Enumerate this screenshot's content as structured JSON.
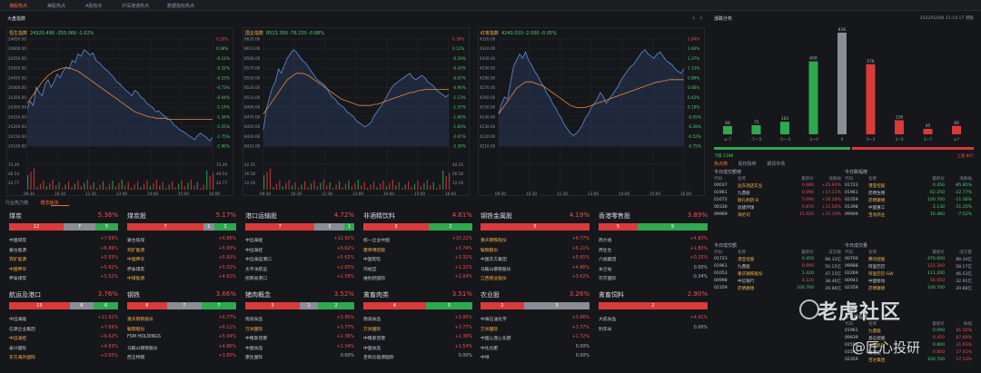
{
  "top_tabs": [
    "港股热点",
    "美股热点",
    "A股热点",
    "沪深港通热点",
    "数据指标热点"
  ],
  "section_title": "大盘指数",
  "charts": [
    {
      "name": "恒生指数",
      "value": "24320.490 -250.060 -1.02%",
      "y_labels": [
        "24650.00",
        "24600.00",
        "24550.00",
        "24500.00",
        "24450.00",
        "24400.00",
        "24350.00",
        "24300.00",
        "24250.00",
        "24200.00",
        "24150.00",
        "24100.00"
      ],
      "pct_labels": [
        "0.29%",
        "0.08%",
        "-0.12%",
        "-0.32%",
        "-0.53%",
        "-0.73%",
        "-0.94%",
        "-1.14%",
        "-1.34%",
        "-1.55%",
        "-1.75%",
        "-1.96%"
      ],
      "vol_labels": [
        "74.39",
        "48.54",
        "24.77"
      ],
      "vol_labels_r": [
        "74.39",
        "49.54",
        "24.77"
      ],
      "x_labels": [
        "09:30",
        "10:30",
        "11:30",
        "13:00",
        "14:00",
        "15:00",
        "16:00"
      ],
      "line": [
        0.35,
        0.42,
        0.38,
        0.55,
        0.5,
        0.47,
        0.58,
        0.62,
        0.55,
        0.6,
        0.67,
        0.64,
        0.7,
        0.74,
        0.72,
        0.8,
        0.78,
        0.86,
        0.84,
        0.9,
        0.88,
        0.85,
        0.87,
        0.8,
        0.78,
        0.75,
        0.72,
        0.7,
        0.67,
        0.64,
        0.6,
        0.58,
        0.55,
        0.52,
        0.5,
        0.47,
        0.52,
        0.5,
        0.46,
        0.44,
        0.4,
        0.38,
        0.36,
        0.32,
        0.33,
        0.3,
        0.28,
        0.26,
        0.24,
        0.2,
        0.18,
        0.15,
        0.14,
        0.12,
        0.1,
        0.08,
        0.06,
        0.1,
        0.12,
        0.1,
        0.08,
        0.05,
        0.08
      ],
      "avg": [
        0.4,
        0.44,
        0.48,
        0.52,
        0.56,
        0.6,
        0.63,
        0.66,
        0.68,
        0.7,
        0.71,
        0.72,
        0.73,
        0.73,
        0.73,
        0.72,
        0.71,
        0.7,
        0.68,
        0.66,
        0.64,
        0.62,
        0.6,
        0.58,
        0.56,
        0.54,
        0.52,
        0.5,
        0.48,
        0.46,
        0.44,
        0.42,
        0.4,
        0.38,
        0.36,
        0.34,
        0.32,
        0.31,
        0.3,
        0.29,
        0.28,
        0.27,
        0.27,
        0.26,
        0.26,
        0.26,
        0.26,
        0.25,
        0.25,
        0.25,
        0.25,
        0.25,
        0.25,
        0.25,
        0.25,
        0.25,
        0.25,
        0.25,
        0.25,
        0.25,
        0.25,
        0.25,
        0.25
      ]
    },
    {
      "name": "国企指数",
      "value": "8513.300 -76.230 -0.88%",
      "y_labels": [
        "8620.00",
        "8610.00",
        "8590.00",
        "8570.00",
        "8550.00",
        "8530.00",
        "8510.00",
        "8490.00",
        "8470.00",
        "8450.00",
        "8430.00",
        "8410.00"
      ],
      "pct_labels": [
        "0.38%",
        "0.12%",
        "-0.19%",
        "-0.43%",
        "-0.67%",
        "-0.90%",
        "-1.13%",
        "-1.37%",
        "-1.60%",
        "-1.83%",
        "-2.07%",
        "-2.30%"
      ],
      "vol_labels": [
        "42.35",
        "26.58",
        "12.29"
      ],
      "vol_labels_r": [
        "40.25",
        "26.58",
        "12.29"
      ],
      "x_labels": [
        "09:30",
        "10:30",
        "11:30",
        "13:00",
        "14:00",
        "15:00",
        "16:00"
      ],
      "line": [
        0.15,
        0.35,
        0.45,
        0.55,
        0.6,
        0.72,
        0.68,
        0.75,
        0.82,
        0.86,
        0.9,
        0.88,
        0.84,
        0.8,
        0.78,
        0.74,
        0.7,
        0.66,
        0.62,
        0.6,
        0.58,
        0.55,
        0.5,
        0.46,
        0.44,
        0.4,
        0.38,
        0.36,
        0.32,
        0.3,
        0.28,
        0.24,
        0.22,
        0.2,
        0.18,
        0.2,
        0.22,
        0.28,
        0.32,
        0.36,
        0.4,
        0.45,
        0.5,
        0.55,
        0.58,
        0.6,
        0.62,
        0.64,
        0.66,
        0.68,
        0.64,
        0.62,
        0.64,
        0.66,
        0.64,
        0.6,
        0.58,
        0.56,
        0.52,
        0.5,
        0.48,
        0.46,
        0.48
      ],
      "avg": [
        0.3,
        0.34,
        0.38,
        0.42,
        0.46,
        0.5,
        0.54,
        0.58,
        0.62,
        0.64,
        0.66,
        0.68,
        0.68,
        0.68,
        0.67,
        0.66,
        0.64,
        0.62,
        0.6,
        0.58,
        0.56,
        0.54,
        0.52,
        0.5,
        0.48,
        0.46,
        0.44,
        0.43,
        0.42,
        0.41,
        0.4,
        0.39,
        0.38,
        0.38,
        0.38,
        0.38,
        0.38,
        0.39,
        0.39,
        0.4,
        0.41,
        0.42,
        0.43,
        0.44,
        0.45,
        0.46,
        0.47,
        0.48,
        0.49,
        0.5,
        0.5,
        0.51,
        0.52,
        0.52,
        0.53,
        0.53,
        0.53,
        0.53,
        0.53,
        0.53,
        0.53,
        0.53,
        0.53
      ]
    },
    {
      "name": "红筹指数",
      "value": "4243.010 -2.000 -0.05%",
      "y_labels": [
        "4320.00",
        "4310.00",
        "4300.00",
        "4290.00",
        "4280.00",
        "4270.00",
        "4260.00",
        "4250.00",
        "4240.00",
        "4230.00",
        "4220.00",
        "4210.00"
      ],
      "pct_labels": [
        "1.84%",
        "1.60%",
        "1.37%",
        "1.13%",
        "0.89%",
        "0.66%",
        "0.42%",
        "0.19%",
        "-0.05%",
        "-0.28%",
        "-0.52%",
        "-0.75%"
      ],
      "vol_labels": [
        "",
        "",
        ""
      ],
      "vol_labels_r": [
        "",
        "",
        ""
      ],
      "x_labels": [
        "09:30",
        "10:30",
        "11:30",
        "13:00",
        "14:00",
        "15:00",
        "16:00"
      ],
      "line": [
        0.3,
        0.4,
        0.46,
        0.44,
        0.6,
        0.75,
        0.8,
        0.86,
        0.82,
        0.88,
        0.8,
        0.76,
        0.7,
        0.66,
        0.6,
        0.56,
        0.5,
        0.46,
        0.4,
        0.36,
        0.3,
        0.26,
        0.2,
        0.16,
        0.12,
        0.1,
        0.12,
        0.15,
        0.2,
        0.26,
        0.3,
        0.36,
        0.4,
        0.44,
        0.5,
        0.46,
        0.4,
        0.44,
        0.48,
        0.52,
        0.56,
        0.62,
        0.66,
        0.7,
        0.74,
        0.76,
        0.8,
        0.84,
        0.88,
        0.9,
        0.86,
        0.84,
        0.82,
        0.86,
        0.88,
        0.84,
        0.8,
        0.78,
        0.76,
        0.72,
        0.7,
        0.68,
        0.72
      ],
      "avg": [
        0.3,
        0.34,
        0.38,
        0.42,
        0.46,
        0.5,
        0.54,
        0.56,
        0.58,
        0.6,
        0.6,
        0.6,
        0.59,
        0.58,
        0.57,
        0.56,
        0.54,
        0.52,
        0.5,
        0.48,
        0.46,
        0.44,
        0.42,
        0.4,
        0.38,
        0.37,
        0.36,
        0.36,
        0.36,
        0.36,
        0.37,
        0.38,
        0.39,
        0.4,
        0.41,
        0.42,
        0.43,
        0.44,
        0.45,
        0.46,
        0.47,
        0.48,
        0.49,
        0.5,
        0.51,
        0.52,
        0.53,
        0.54,
        0.55,
        0.56,
        0.57,
        0.58,
        0.59,
        0.6,
        0.6,
        0.61,
        0.61,
        0.62,
        0.62,
        0.62,
        0.62,
        0.62,
        0.62
      ]
    }
  ],
  "sector_tabs": [
    "行业热力榜",
    "概念板块"
  ],
  "sectors": [
    {
      "name": "煤炭",
      "pct": "5.36%",
      "bar": [
        12,
        7,
        5
      ],
      "stocks": [
        [
          "中国煤炭",
          "+7.69%",
          false
        ],
        [
          "蒙古能源",
          "+6.86%",
          false
        ],
        [
          "兖矿能源",
          "+5.93%",
          true
        ],
        [
          "中国神华",
          "+5.92%",
          true
        ],
        [
          "伊泰煤炭",
          "+5.52%",
          false
        ]
      ]
    },
    {
      "name": "煤炭股",
      "pct": "5.17%",
      "bar": [
        7,
        1,
        2
      ],
      "stocks": [
        [
          "蒙古焦煤",
          "+6.86%",
          false
        ],
        [
          "兖矿能源",
          "+5.93%",
          true
        ],
        [
          "中国神华",
          "+5.92%",
          true
        ],
        [
          "伊泰煤炭",
          "+5.52%",
          false
        ],
        [
          "中煤能源",
          "+4.62%",
          true
        ]
      ]
    },
    {
      "name": "港口运输股",
      "pct": "4.72%",
      "bar": [
        7,
        3,
        1
      ],
      "stocks": [
        [
          "中远海能",
          "+11.92%",
          false
        ],
        [
          "中远海控",
          "+6.62%",
          false
        ],
        [
          "中远海运港口",
          "+5.62%",
          false
        ],
        [
          "太平洋航运",
          "+2.65%",
          false
        ],
        [
          "招商局港口",
          "+2.58%",
          false
        ]
      ]
    },
    {
      "name": "非酒精饮料",
      "pct": "4.61%",
      "bar": [
        3,
        0,
        2
      ],
      "stocks": [
        [
          "统一企业中国",
          "+10.22%",
          false
        ],
        [
          "康师傅控股",
          "+3.74%",
          true
        ],
        [
          "中国旺旺",
          "+3.32%",
          false
        ],
        [
          "鸿福堂",
          "+1.32%",
          false
        ],
        [
          "维他奶国际",
          "+1.04%",
          false
        ]
      ]
    },
    {
      "name": "钢铁金属股",
      "pct": "4.19%",
      "bar": [
        5,
        0,
        0
      ],
      "stocks": [
        [
          "重庆钢铁股份",
          "+6.77%",
          true
        ],
        [
          "鞍钢股份",
          "+6.11%",
          true
        ],
        [
          "中国东方集团",
          "+5.65%",
          false
        ],
        [
          "马鞍山钢铁股份",
          "+4.86%",
          false
        ],
        [
          "江西铜业股份",
          "+3.62%",
          true
        ]
      ]
    },
    {
      "name": "香港零售股",
      "pct": "3.89%",
      "bar": [
        5,
        0,
        9
      ],
      "stocks": [
        [
          "周大福",
          "+4.83%",
          false
        ],
        [
          "周生生",
          "+1.83%",
          false
        ],
        [
          "六福集团",
          "+0.25%",
          false
        ],
        [
          "米兰站",
          "0.00%",
          false
        ],
        [
          "莎莎国际",
          "-0.34%",
          false
        ]
      ]
    },
    {
      "name": "航运及港口",
      "pct": "3.76%",
      "bar": [
        15,
        6,
        6
      ],
      "stocks": [
        [
          "中远海能",
          "+11.92%",
          false
        ],
        [
          "信源企业集团",
          "+7.69%",
          false
        ],
        [
          "中远海控",
          "+6.62%",
          true
        ],
        [
          "泰兴国际",
          "+4.63%",
          false
        ],
        [
          "东方海外国际",
          "+3.65%",
          true
        ]
      ]
    },
    {
      "name": "钢铁",
      "pct": "3.66%",
      "bar": [
        8,
        7,
        7
      ],
      "stocks": [
        [
          "重庆钢铁股份",
          "+6.77%",
          true
        ],
        [
          "鞍钢股份",
          "+6.11%",
          true
        ],
        [
          "FSM HOLDINGS",
          "+5.94%",
          false
        ],
        [
          "马鞍山钢铁股份",
          "+4.86%",
          false
        ],
        [
          "西王特钢",
          "+3.85%",
          false
        ]
      ]
    },
    {
      "name": "猪肉概念",
      "pct": "3.52%",
      "bar": [
        3,
        1,
        2
      ],
      "stocks": [
        [
          "雨润食品",
          "+3.95%",
          false
        ],
        [
          "万洲国际",
          "+3.77%",
          true
        ],
        [
          "中粮家佳康",
          "+1.36%",
          false
        ],
        [
          "中国食品",
          "+1.34%",
          false
        ],
        [
          "康生国际",
          "0.00%",
          false
        ]
      ]
    },
    {
      "name": "禽畜肉类",
      "pct": "3.51%",
      "bar": [
        4,
        0,
        3
      ],
      "stocks": [
        [
          "雨润食品",
          "+3.95%",
          false
        ],
        [
          "万洲国际",
          "+3.77%",
          true
        ],
        [
          "中粮家佳康",
          "+1.36%",
          false
        ],
        [
          "中国食品",
          "+1.54%",
          false
        ],
        [
          "百和比能源国际",
          "0.00%",
          false
        ]
      ]
    },
    {
      "name": "农业股",
      "pct": "3.26%",
      "bar": [
        2,
        3,
        0
      ],
      "stocks": [
        [
          "中海石油化学",
          "+3.96%",
          false
        ],
        [
          "万洲国际",
          "+3.77%",
          true
        ],
        [
          "中国心连心化肥",
          "+1.72%",
          false
        ],
        [
          "中化化肥",
          "0.00%",
          false
        ],
        [
          "中绿",
          "0.00%",
          false
        ]
      ]
    },
    {
      "name": "禽畜饲料",
      "pct": "2.90%",
      "bar": [
        2,
        0,
        0
      ],
      "stocks": [
        [
          "大成食品",
          "+4.41%",
          false
        ],
        [
          "利华米",
          "0.00%",
          false
        ]
      ]
    }
  ],
  "distribution": {
    "title": "涨跌分布",
    "datetime": "2022/02/08 21:14:17 港股",
    "categories": [
      "≤-7",
      "-7~-5",
      "-5~-3",
      "-3~0",
      "0",
      "0~3",
      "3~5",
      "5~7",
      "≥7"
    ],
    "values": [
      68,
      75,
      103,
      600,
      836,
      576,
      116,
      45,
      69
    ],
    "colors": [
      "#2fa84f",
      "#2fa84f",
      "#2fa84f",
      "#2fa84f",
      "#8a8d94",
      "#d93a3a",
      "#d93a3a",
      "#d93a3a",
      "#d93a3a"
    ],
    "down_label": "下跌 1196",
    "up_label": "上涨 807"
  },
  "hot_tabs": [
    "热点榜",
    "股权融券",
    "期货市场"
  ],
  "tables": [
    {
      "title": "今日成交额榜",
      "headers": [
        "代码",
        "名称",
        "最新价",
        "涨跌幅"
      ],
      "rows": [
        [
          "00037",
          "远东酒店实业",
          "0.680",
          "+25.93%",
          true
        ],
        [
          "01961",
          "九鼎股",
          "0.090",
          "+17.11%",
          false
        ],
        [
          "01672",
          "歌礼制药-B",
          "5.090",
          "+16.28%",
          false
        ],
        [
          "00330",
          "思捷环球",
          "0.870",
          "+11.54%",
          false
        ],
        [
          "09969",
          "海伦司",
          "15.920",
          "+11.19%",
          false
        ]
      ]
    },
    {
      "title": "今日跌幅榜",
      "headers": [
        "代码",
        "名称",
        "最新价",
        "涨跌幅"
      ],
      "rows": [
        [
          "01723",
          "港亚控股",
          "0.450",
          "-85.85%",
          false
        ],
        [
          "01961",
          "药明生物",
          "62.250",
          "-22.77%",
          false
        ],
        [
          "02359",
          "药明康德",
          "100.700",
          "-11.36%",
          false
        ],
        [
          "01398",
          "中国重工",
          "2.130",
          "-11.25%",
          false
        ],
        [
          "09909",
          "宝龙商业",
          "16.480",
          "-7.52%",
          false
        ]
      ]
    },
    {
      "title": "今日成交额",
      "headers": [
        "代码",
        "名称",
        "最新价",
        "成交额"
      ],
      "rows": [
        [
          "01723",
          "港亚控股",
          "0.450",
          "88.33亿",
          false
        ],
        [
          "01961",
          "九鼎股",
          "0.090",
          "50.15亿",
          false
        ],
        [
          "01053",
          "重庆钢铁股份",
          "1.420",
          "47.15亿",
          false
        ],
        [
          "00998",
          "中信银行",
          "4.120",
          "38.46亿",
          false
        ],
        [
          "02359",
          "药明康德",
          "100.700",
          "29.88亿",
          false
        ]
      ]
    },
    {
      "title": "今日成交量",
      "headers": [
        "代码",
        "名称",
        "最新价",
        "成交量"
      ],
      "rows": [
        [
          "00700",
          "腾讯控股",
          "470.000",
          "88.34亿",
          false
        ],
        [
          "09988",
          "阿里巴巴",
          "125.300",
          "58.17亿",
          false
        ],
        [
          "02269",
          "阿里巴巴-SW",
          "111.200",
          "46.53亿",
          false
        ],
        [
          "00941",
          "中国移动",
          "56.050",
          "32.91亿",
          false
        ],
        [
          "02359",
          "药明康德",
          "100.700",
          "29.88亿",
          false
        ]
      ]
    },
    {
      "title": "今日振幅榜",
      "headers": [
        "代码",
        "名称",
        "最新价",
        "振幅"
      ],
      "rows": [
        [
          "01961",
          "九鼎股",
          "0.090",
          "81.56%",
          false
        ],
        [
          "09939",
          "基石控股",
          "0.450",
          "87.84%",
          false
        ],
        [
          "01598",
          "中国移动",
          "0.800",
          "31.63%",
          false
        ],
        [
          "01592",
          "康而健",
          "0.850",
          "27.41%",
          false
        ],
        [
          "02359",
          "百达集团",
          "100.700",
          "27.13%",
          false
        ]
      ]
    }
  ],
  "watermark": {
    "main": "老虎社区",
    "sub": "@匠心投研"
  }
}
